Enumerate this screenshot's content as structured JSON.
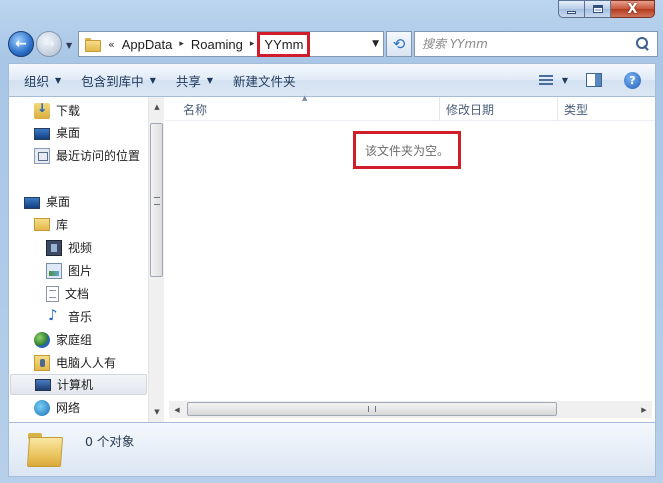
{
  "caption": {
    "close_glyph": "X"
  },
  "address": {
    "chevron": "«",
    "crumbs": [
      "AppData",
      "Roaming"
    ],
    "separator": "▸",
    "current": "YYmm",
    "dropdown": "▼"
  },
  "search": {
    "placeholder": "搜索 YYmm"
  },
  "toolbar": {
    "organize": "组织",
    "include_in_library": "包含到库中",
    "share": "共享",
    "new_folder": "新建文件夹",
    "help_glyph": "?"
  },
  "navpane": {
    "items": [
      {
        "label": "下载",
        "icon": "download-folder-icon"
      },
      {
        "label": "桌面",
        "icon": "desktop-icon"
      },
      {
        "label": "最近访问的位置",
        "icon": "recent-places-icon"
      },
      {
        "label": "桌面",
        "icon": "desktop-icon"
      },
      {
        "label": "库",
        "icon": "library-icon"
      },
      {
        "label": "视频",
        "icon": "video-icon"
      },
      {
        "label": "图片",
        "icon": "pictures-icon"
      },
      {
        "label": "文档",
        "icon": "documents-icon"
      },
      {
        "label": "音乐",
        "icon": "music-icon"
      },
      {
        "label": "家庭组",
        "icon": "homegroup-icon"
      },
      {
        "label": "电脑人人有",
        "icon": "user-folder-icon"
      },
      {
        "label": "计算机",
        "icon": "computer-icon"
      },
      {
        "label": "网络",
        "icon": "network-icon"
      }
    ]
  },
  "columns": {
    "name": "名称",
    "date_modified": "修改日期",
    "type": "类型"
  },
  "content": {
    "empty_message": "该文件夹为空。"
  },
  "status": {
    "item_count": "0 个对象"
  },
  "colors": {
    "highlight_box": "#d11d2a",
    "toolbar_text": "#1e395b"
  }
}
